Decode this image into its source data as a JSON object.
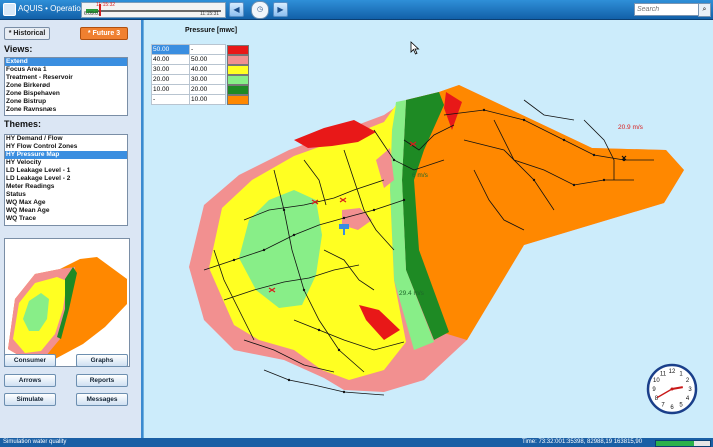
{
  "titlebar": {
    "app_title": "AQUIS • Operation",
    "timeline_label_top": "11:15:32",
    "timeline_label_left": "6:09:01",
    "timeline_label_right": "11:15:31",
    "timeline_progress": 0.09,
    "search_placeholder": "Search"
  },
  "sidebar": {
    "historical_label": "* Historical",
    "future_label": "* Future 3",
    "views_title": "Views:",
    "views": [
      {
        "label": "Extend",
        "selected": true
      },
      {
        "label": "Focus Area 1",
        "selected": false
      },
      {
        "label": "Treatment - Reservoir",
        "selected": false
      },
      {
        "label": "Zone Birkerød",
        "selected": false
      },
      {
        "label": "Zone Bispehaven",
        "selected": false
      },
      {
        "label": "Zone Bistrup",
        "selected": false
      },
      {
        "label": "Zone Ravnsnæs",
        "selected": false
      }
    ],
    "themes_title": "Themes:",
    "themes": [
      {
        "label": "HY Demand / Flow",
        "selected": false
      },
      {
        "label": "HY Flow Control Zones",
        "selected": false
      },
      {
        "label": "HY Pressure Map",
        "selected": true
      },
      {
        "label": "HY Velocity",
        "selected": false
      },
      {
        "label": "LD Leakage Level - 1",
        "selected": false
      },
      {
        "label": "LD Leakage Level - 2",
        "selected": false
      },
      {
        "label": "Meter Readings",
        "selected": false
      },
      {
        "label": "Status",
        "selected": false
      },
      {
        "label": "WQ Max Age",
        "selected": false
      },
      {
        "label": "WQ Mean Age",
        "selected": false
      },
      {
        "label": "WQ Trace",
        "selected": false
      }
    ],
    "buttons": {
      "consumer": "Consumer",
      "graphs": "Graphs",
      "arrows": "Arrows",
      "reports": "Reports",
      "simulate": "Simulate",
      "messages": "Messages"
    }
  },
  "legend": {
    "title": "Pressure [mwc]",
    "rows": [
      {
        "from": "50.00",
        "to": "-",
        "color": "#e81818"
      },
      {
        "from": "40.00",
        "to": "50.00",
        "color": "#f29090"
      },
      {
        "from": "30.00",
        "to": "40.00",
        "color": "#ffff22"
      },
      {
        "from": "20.00",
        "to": "30.00",
        "color": "#88ee88"
      },
      {
        "from": "10.00",
        "to": "20.00",
        "color": "#1e8a24"
      },
      {
        "from": "-",
        "to": "10.00",
        "color": "#ff8800"
      }
    ]
  },
  "map": {
    "label_1": "20.9 m/s",
    "label_2": "29.4 m/s",
    "label_3": "6 m/s"
  },
  "clock": {
    "hour": 2,
    "minute": 40
  },
  "status": {
    "text": "Simulation water quality",
    "time": "Time: 73:32:00",
    "coords": "1:35398, 82988,19 163815,90",
    "progress": 0.7
  },
  "colors": {
    "titlebar": "#1a6fc0",
    "selected": "#3a8ee0",
    "future_button": "#f08030"
  }
}
